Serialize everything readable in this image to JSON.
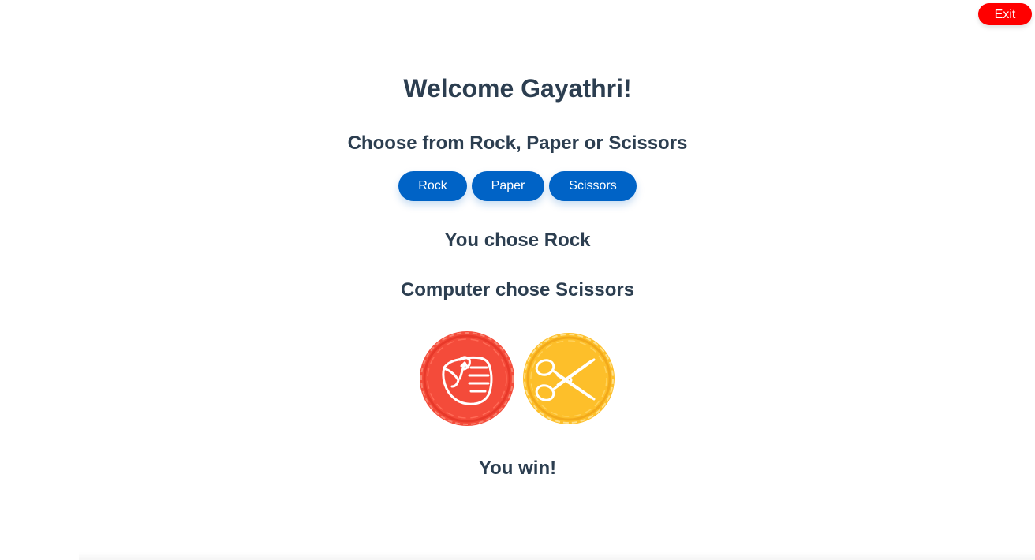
{
  "header": {
    "exit_label": "Exit"
  },
  "welcome": {
    "title": "Welcome Gayathri!"
  },
  "prompt": {
    "text": "Choose from Rock, Paper or Scissors"
  },
  "choices": [
    {
      "label": "Rock"
    },
    {
      "label": "Paper"
    },
    {
      "label": "Scissors"
    }
  ],
  "result": {
    "player_choice_text": "You chose Rock",
    "computer_choice_text": "Computer chose Scissors",
    "outcome_text": "You win!"
  },
  "icons": {
    "player": "rock-fist-icon",
    "computer": "scissors-icon"
  },
  "colors": {
    "exit": "#ff0000",
    "button": "#0063c6",
    "text": "#2c3e50",
    "rock_coin": "#f44b3a",
    "scissors_coin": "#fdbf2a"
  }
}
